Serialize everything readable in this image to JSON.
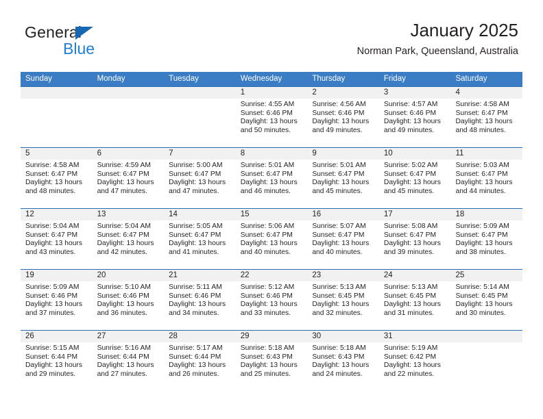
{
  "brand": {
    "name_top": "General",
    "name_bottom": "Blue",
    "accent_color": "#1668b3",
    "blue_text_color": "#1f7fd4"
  },
  "header": {
    "title": "January 2025",
    "subtitle": "Norman Park, Queensland, Australia"
  },
  "theme": {
    "header_row_bg": "#3b7dc4",
    "week_separator": "#2b6cb0",
    "day_band_bg": "#f1f1f1",
    "text_color": "#231f20"
  },
  "weekdays": [
    "Sunday",
    "Monday",
    "Tuesday",
    "Wednesday",
    "Thursday",
    "Friday",
    "Saturday"
  ],
  "weeks": [
    [
      {
        "day": "",
        "sunrise": "",
        "sunset": "",
        "daylight_line1": "",
        "daylight_line2": ""
      },
      {
        "day": "",
        "sunrise": "",
        "sunset": "",
        "daylight_line1": "",
        "daylight_line2": ""
      },
      {
        "day": "",
        "sunrise": "",
        "sunset": "",
        "daylight_line1": "",
        "daylight_line2": ""
      },
      {
        "day": "1",
        "sunrise": "Sunrise: 4:55 AM",
        "sunset": "Sunset: 6:46 PM",
        "daylight_line1": "Daylight: 13 hours",
        "daylight_line2": "and 50 minutes."
      },
      {
        "day": "2",
        "sunrise": "Sunrise: 4:56 AM",
        "sunset": "Sunset: 6:46 PM",
        "daylight_line1": "Daylight: 13 hours",
        "daylight_line2": "and 49 minutes."
      },
      {
        "day": "3",
        "sunrise": "Sunrise: 4:57 AM",
        "sunset": "Sunset: 6:46 PM",
        "daylight_line1": "Daylight: 13 hours",
        "daylight_line2": "and 49 minutes."
      },
      {
        "day": "4",
        "sunrise": "Sunrise: 4:58 AM",
        "sunset": "Sunset: 6:47 PM",
        "daylight_line1": "Daylight: 13 hours",
        "daylight_line2": "and 48 minutes."
      }
    ],
    [
      {
        "day": "5",
        "sunrise": "Sunrise: 4:58 AM",
        "sunset": "Sunset: 6:47 PM",
        "daylight_line1": "Daylight: 13 hours",
        "daylight_line2": "and 48 minutes."
      },
      {
        "day": "6",
        "sunrise": "Sunrise: 4:59 AM",
        "sunset": "Sunset: 6:47 PM",
        "daylight_line1": "Daylight: 13 hours",
        "daylight_line2": "and 47 minutes."
      },
      {
        "day": "7",
        "sunrise": "Sunrise: 5:00 AM",
        "sunset": "Sunset: 6:47 PM",
        "daylight_line1": "Daylight: 13 hours",
        "daylight_line2": "and 47 minutes."
      },
      {
        "day": "8",
        "sunrise": "Sunrise: 5:01 AM",
        "sunset": "Sunset: 6:47 PM",
        "daylight_line1": "Daylight: 13 hours",
        "daylight_line2": "and 46 minutes."
      },
      {
        "day": "9",
        "sunrise": "Sunrise: 5:01 AM",
        "sunset": "Sunset: 6:47 PM",
        "daylight_line1": "Daylight: 13 hours",
        "daylight_line2": "and 45 minutes."
      },
      {
        "day": "10",
        "sunrise": "Sunrise: 5:02 AM",
        "sunset": "Sunset: 6:47 PM",
        "daylight_line1": "Daylight: 13 hours",
        "daylight_line2": "and 45 minutes."
      },
      {
        "day": "11",
        "sunrise": "Sunrise: 5:03 AM",
        "sunset": "Sunset: 6:47 PM",
        "daylight_line1": "Daylight: 13 hours",
        "daylight_line2": "and 44 minutes."
      }
    ],
    [
      {
        "day": "12",
        "sunrise": "Sunrise: 5:04 AM",
        "sunset": "Sunset: 6:47 PM",
        "daylight_line1": "Daylight: 13 hours",
        "daylight_line2": "and 43 minutes."
      },
      {
        "day": "13",
        "sunrise": "Sunrise: 5:04 AM",
        "sunset": "Sunset: 6:47 PM",
        "daylight_line1": "Daylight: 13 hours",
        "daylight_line2": "and 42 minutes."
      },
      {
        "day": "14",
        "sunrise": "Sunrise: 5:05 AM",
        "sunset": "Sunset: 6:47 PM",
        "daylight_line1": "Daylight: 13 hours",
        "daylight_line2": "and 41 minutes."
      },
      {
        "day": "15",
        "sunrise": "Sunrise: 5:06 AM",
        "sunset": "Sunset: 6:47 PM",
        "daylight_line1": "Daylight: 13 hours",
        "daylight_line2": "and 40 minutes."
      },
      {
        "day": "16",
        "sunrise": "Sunrise: 5:07 AM",
        "sunset": "Sunset: 6:47 PM",
        "daylight_line1": "Daylight: 13 hours",
        "daylight_line2": "and 40 minutes."
      },
      {
        "day": "17",
        "sunrise": "Sunrise: 5:08 AM",
        "sunset": "Sunset: 6:47 PM",
        "daylight_line1": "Daylight: 13 hours",
        "daylight_line2": "and 39 minutes."
      },
      {
        "day": "18",
        "sunrise": "Sunrise: 5:09 AM",
        "sunset": "Sunset: 6:47 PM",
        "daylight_line1": "Daylight: 13 hours",
        "daylight_line2": "and 38 minutes."
      }
    ],
    [
      {
        "day": "19",
        "sunrise": "Sunrise: 5:09 AM",
        "sunset": "Sunset: 6:46 PM",
        "daylight_line1": "Daylight: 13 hours",
        "daylight_line2": "and 37 minutes."
      },
      {
        "day": "20",
        "sunrise": "Sunrise: 5:10 AM",
        "sunset": "Sunset: 6:46 PM",
        "daylight_line1": "Daylight: 13 hours",
        "daylight_line2": "and 36 minutes."
      },
      {
        "day": "21",
        "sunrise": "Sunrise: 5:11 AM",
        "sunset": "Sunset: 6:46 PM",
        "daylight_line1": "Daylight: 13 hours",
        "daylight_line2": "and 34 minutes."
      },
      {
        "day": "22",
        "sunrise": "Sunrise: 5:12 AM",
        "sunset": "Sunset: 6:46 PM",
        "daylight_line1": "Daylight: 13 hours",
        "daylight_line2": "and 33 minutes."
      },
      {
        "day": "23",
        "sunrise": "Sunrise: 5:13 AM",
        "sunset": "Sunset: 6:45 PM",
        "daylight_line1": "Daylight: 13 hours",
        "daylight_line2": "and 32 minutes."
      },
      {
        "day": "24",
        "sunrise": "Sunrise: 5:13 AM",
        "sunset": "Sunset: 6:45 PM",
        "daylight_line1": "Daylight: 13 hours",
        "daylight_line2": "and 31 minutes."
      },
      {
        "day": "25",
        "sunrise": "Sunrise: 5:14 AM",
        "sunset": "Sunset: 6:45 PM",
        "daylight_line1": "Daylight: 13 hours",
        "daylight_line2": "and 30 minutes."
      }
    ],
    [
      {
        "day": "26",
        "sunrise": "Sunrise: 5:15 AM",
        "sunset": "Sunset: 6:44 PM",
        "daylight_line1": "Daylight: 13 hours",
        "daylight_line2": "and 29 minutes."
      },
      {
        "day": "27",
        "sunrise": "Sunrise: 5:16 AM",
        "sunset": "Sunset: 6:44 PM",
        "daylight_line1": "Daylight: 13 hours",
        "daylight_line2": "and 27 minutes."
      },
      {
        "day": "28",
        "sunrise": "Sunrise: 5:17 AM",
        "sunset": "Sunset: 6:44 PM",
        "daylight_line1": "Daylight: 13 hours",
        "daylight_line2": "and 26 minutes."
      },
      {
        "day": "29",
        "sunrise": "Sunrise: 5:18 AM",
        "sunset": "Sunset: 6:43 PM",
        "daylight_line1": "Daylight: 13 hours",
        "daylight_line2": "and 25 minutes."
      },
      {
        "day": "30",
        "sunrise": "Sunrise: 5:18 AM",
        "sunset": "Sunset: 6:43 PM",
        "daylight_line1": "Daylight: 13 hours",
        "daylight_line2": "and 24 minutes."
      },
      {
        "day": "31",
        "sunrise": "Sunrise: 5:19 AM",
        "sunset": "Sunset: 6:42 PM",
        "daylight_line1": "Daylight: 13 hours",
        "daylight_line2": "and 22 minutes."
      },
      {
        "day": "",
        "sunrise": "",
        "sunset": "",
        "daylight_line1": "",
        "daylight_line2": ""
      }
    ]
  ]
}
